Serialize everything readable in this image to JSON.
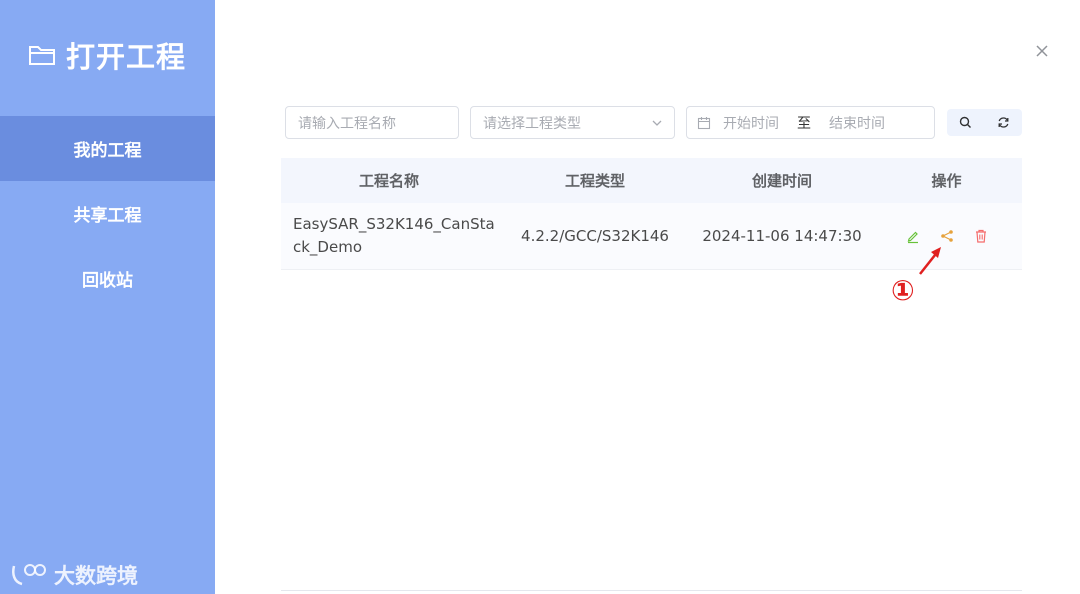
{
  "sidebar": {
    "title": "打开工程",
    "items": [
      {
        "label": "我的工程",
        "active": true
      },
      {
        "label": "共享工程",
        "active": false
      },
      {
        "label": "回收站",
        "active": false
      }
    ],
    "watermark": "大数跨境"
  },
  "filters": {
    "search_placeholder": "请输入工程名称",
    "type_placeholder": "请选择工程类型",
    "start_placeholder": "开始时间",
    "range_separator": "至",
    "end_placeholder": "结束时间"
  },
  "table": {
    "headers": [
      "工程名称",
      "工程类型",
      "创建时间",
      "操作"
    ],
    "rows": [
      {
        "name": "EasySAR_S32K146_CanStack_Demo",
        "type": "4.2.2/GCC/S32K146",
        "created": "2024-11-06 14:47:30"
      }
    ]
  },
  "annotation": {
    "label": "①"
  },
  "colors": {
    "sidebar": "#87aaf3",
    "sidebar_active": "#6a8ddf",
    "edit": "#67c23a",
    "share": "#e6a23c",
    "delete": "#f56c6c",
    "annotation": "#e02020"
  }
}
